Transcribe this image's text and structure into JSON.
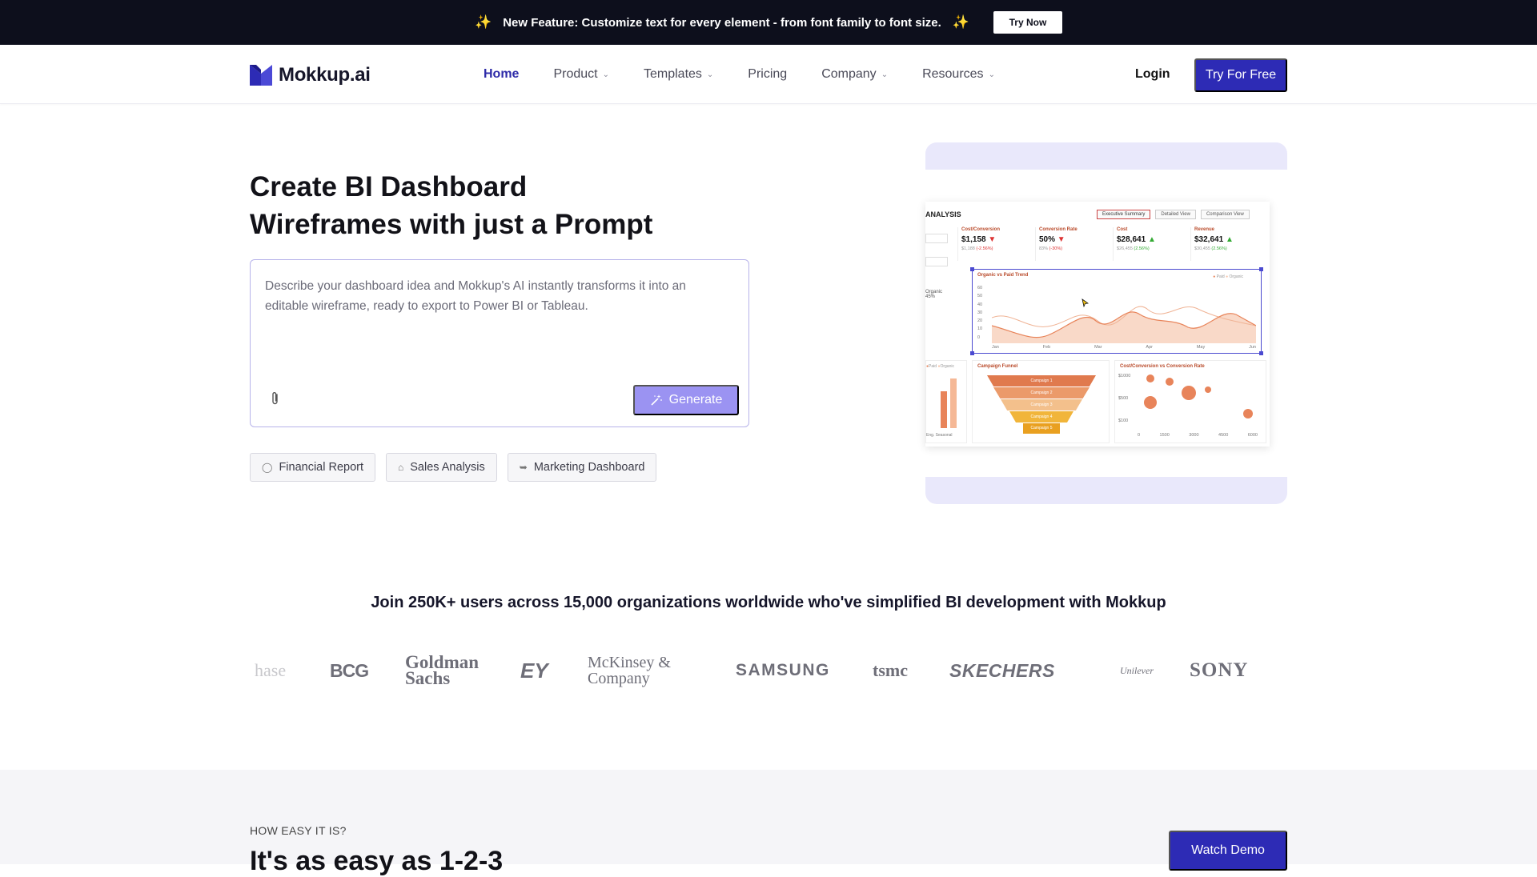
{
  "announcement": {
    "text": "New Feature: Customize text for every element - from font family to font size.",
    "sparkle": "✨",
    "cta": "Try Now"
  },
  "header": {
    "logo_text": "Mokkup.ai",
    "nav": [
      {
        "label": "Home",
        "active": true,
        "dropdown": false
      },
      {
        "label": "Product",
        "active": false,
        "dropdown": true
      },
      {
        "label": "Templates",
        "active": false,
        "dropdown": true
      },
      {
        "label": "Pricing",
        "active": false,
        "dropdown": false
      },
      {
        "label": "Company",
        "active": false,
        "dropdown": true
      },
      {
        "label": "Resources",
        "active": false,
        "dropdown": true
      }
    ],
    "login": "Login",
    "cta": "Try For Free"
  },
  "hero": {
    "title_line1": "Create BI Dashboard",
    "title_line2": "Wireframes with just a Prompt",
    "prompt_placeholder": "Describe your dashboard idea and Mokkup's AI instantly transforms it into an editable wireframe, ready to export to Power BI or Tableau.",
    "generate_label": "Generate",
    "chips": [
      "Financial Report",
      "Sales Analysis",
      "Marketing Dashboard"
    ]
  },
  "preview": {
    "title": "ANALYSIS",
    "tabs": [
      "Executive Summary",
      "Detailed View",
      "Comparison View"
    ],
    "kpis": [
      {
        "label": "Cost/Conversion",
        "value": "$1,158",
        "dir": "down",
        "sub_a": "$1,188",
        "sub_b": "(-2.56%)"
      },
      {
        "label": "Conversion Rate",
        "value": "50%",
        "dir": "down",
        "sub_a": "83%",
        "sub_b": "(-30%)"
      },
      {
        "label": "Cost",
        "value": "$28,641",
        "dir": "up",
        "sub_a": "$26,455",
        "sub_b": "(2.56%)"
      },
      {
        "label": "Revenue",
        "value": "$32,641",
        "dir": "up",
        "sub_a": "$30,455",
        "sub_b": "(2.56%)"
      }
    ],
    "trend_title": "Organic vs Paid Trend",
    "trend_legend": [
      "Paid",
      "Organic"
    ],
    "trend_y_ticks": [
      "60",
      "50",
      "40",
      "30",
      "20",
      "10",
      "0"
    ],
    "trend_x_ticks": [
      "Jan",
      "Feb",
      "Mar",
      "Apr",
      "May",
      "Jun"
    ],
    "organic_label": "Organic",
    "organic_value": "45%",
    "bars_legend": [
      "Paid",
      "Organic"
    ],
    "bars_label": "Eng. Seasonal",
    "funnel_title": "Campaign Funnel",
    "funnel_steps": [
      "Campaign 1",
      "Campaign 2",
      "Campaign 3",
      "Campaign 4",
      "Campaign 5"
    ],
    "scatter_title": "Cost/Conversion vs Conversion Rate",
    "scatter_y_ticks": [
      "$1000",
      "$500",
      "$100"
    ],
    "scatter_x_ticks": [
      "0",
      "1500",
      "3000",
      "4500",
      "6000"
    ],
    "accent": "#e8845a"
  },
  "social_proof": {
    "headline": "Join 250K+ users across 15,000 organizations worldwide who've simplified BI development with Mokkup",
    "logos": [
      "hase",
      "BCG",
      "Goldman Sachs",
      "EY",
      "McKinsey & Company",
      "SAMSUNG",
      "tsmc",
      "SKECHERS",
      "Unilever",
      "SONY"
    ]
  },
  "how": {
    "kicker": "HOW EASY IT IS?",
    "title": "It's as easy as 1-2-3",
    "cta": "Watch Demo"
  },
  "colors": {
    "brand": "#2d2bb5",
    "generate": "#9b93f2",
    "announcement_bg": "#0d0f1c"
  }
}
